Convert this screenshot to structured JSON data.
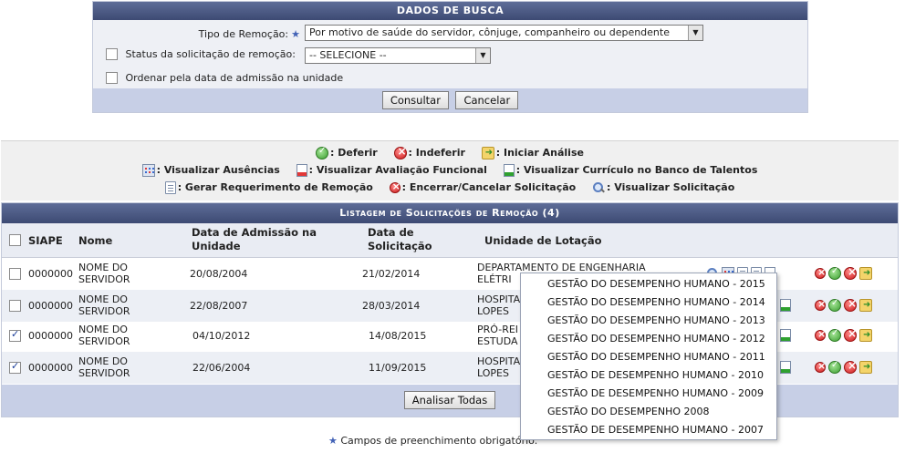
{
  "search": {
    "title": "DADOS DE BUSCA",
    "tipo_label": "Tipo de Remoção:",
    "tipo_value": "Por motivo de saúde do servidor, cônjuge, companheiro ou dependente",
    "status_label": "Status da solicitação de remoção:",
    "status_value": "-- SELECIONE --",
    "ordenar_label": "Ordenar pela data de admissão na unidade",
    "consultar": "Consultar",
    "cancelar": "Cancelar"
  },
  "legend": {
    "deferir": ": Deferir",
    "indeferir": ": Indeferir",
    "iniciar": ": Iniciar Análise",
    "ausencias": ": Visualizar Ausências",
    "avaliacao": ": Visualizar Avaliação Funcional",
    "curriculo": ": Visualizar Currículo no Banco de Talentos",
    "requerimento": ": Gerar Requerimento de Remoção",
    "encerrar": ": Encerrar/Cancelar Solicitação",
    "visualizar": ": Visualizar Solicitação"
  },
  "listing": {
    "title": "Listagem de Solicitações de Remoção (4)",
    "columns": {
      "siape": "SIAPE",
      "nome": "Nome",
      "admissao": "Data de Admissão na Unidade",
      "solicitacao": "Data de Solicitação",
      "unidade": "Unidade de Lotação"
    },
    "rows": [
      {
        "siape": "0000000",
        "nome": "NOME DO SERVIDOR",
        "admissao": "20/08/2004",
        "solicitacao": "21/02/2014",
        "unidade": "DEPARTAMENTO DE ENGENHARIA ELÉTRI",
        "checked": false
      },
      {
        "siape": "0000000",
        "nome": "NOME DO SERVIDOR",
        "admissao": "22/08/2007",
        "solicitacao": "28/03/2014",
        "unidade": "HOSPITA LOPES",
        "checked": false
      },
      {
        "siape": "0000000",
        "nome": "NOME DO SERVIDOR",
        "admissao": "04/10/2012",
        "solicitacao": "14/08/2015",
        "unidade": "PRÓ-REI ESTUDA",
        "checked": true
      },
      {
        "siape": "0000000",
        "nome": "NOME DO SERVIDOR",
        "admissao": "22/06/2004",
        "solicitacao": "11/09/2015",
        "unidade": "HOSPITA LOPES",
        "checked": true
      }
    ],
    "analisar": "Analisar Todas"
  },
  "popup": {
    "options": [
      "GESTÃO DO DESEMPENHO HUMANO - 2015",
      "GESTÃO DO DESEMPENHO HUMANO - 2014",
      "GESTÃO DO DESEMPENHO HUMANO - 2013",
      "GESTÃO DO DESEMPENHO HUMANO - 2012",
      "GESTÃO DO DESEMPENHO HUMANO - 2011",
      "GESTÃO DE DESEMPENHO HUMANO - 2010",
      "GESTÃO DE DESEMPENHO HUMANO - 2009",
      "GESTÃO DO DESEMPENHO 2008",
      "GESTÃO DE DESEMPENHO HUMANO - 2007"
    ]
  },
  "required_note": "Campos de preenchimento obrigatório."
}
